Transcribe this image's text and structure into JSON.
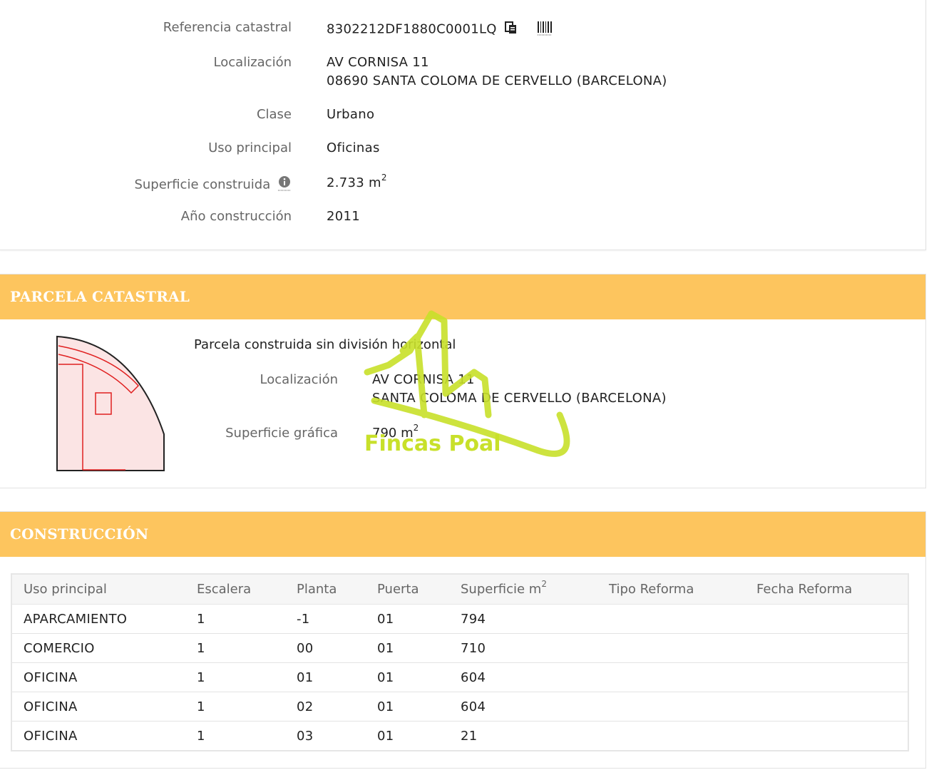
{
  "datos": {
    "referencia": {
      "label": "Referencia catastral",
      "value": "8302212DF1880C0001LQ"
    },
    "localizacion": {
      "label": "Localización",
      "line1": "AV CORNISA 11",
      "line2": "08690 SANTA COLOMA DE CERVELLO (BARCELONA)"
    },
    "clase": {
      "label": "Clase",
      "value": "Urbano"
    },
    "uso": {
      "label": "Uso principal",
      "value": "Oficinas"
    },
    "superficie": {
      "label": "Superficie construida",
      "value": "2.733 m",
      "sup": "2"
    },
    "anio": {
      "label": "Año construcción",
      "value": "2011"
    }
  },
  "parcela": {
    "title": "PARCELA CATASTRAL",
    "descripcion": "Parcela construida sin división horizontal",
    "localizacion": {
      "label": "Localización",
      "line1": "AV CORNISA 11",
      "line2": "SANTA COLOMA DE CERVELLO (BARCELONA)"
    },
    "superficie": {
      "label": "Superficie gráfica",
      "value": "790 m",
      "sup": "2"
    }
  },
  "watermark": {
    "text": "Fincas Poal",
    "color": "#c8e02a"
  },
  "construccion": {
    "title": "CONSTRUCCIÓN",
    "headers": [
      "Uso principal",
      "Escalera",
      "Planta",
      "Puerta",
      "Superficie m",
      "Tipo Reforma",
      "Fecha Reforma"
    ],
    "header_sup": "2",
    "rows": [
      [
        "APARCAMIENTO",
        "1",
        "-1",
        "01",
        "794",
        "",
        ""
      ],
      [
        "COMERCIO",
        "1",
        "00",
        "01",
        "710",
        "",
        ""
      ],
      [
        "OFICINA",
        "1",
        "01",
        "01",
        "604",
        "",
        ""
      ],
      [
        "OFICINA",
        "1",
        "02",
        "01",
        "604",
        "",
        ""
      ],
      [
        "OFICINA",
        "1",
        "03",
        "01",
        "21",
        "",
        ""
      ]
    ]
  },
  "colors": {
    "accent": "#fdc55e",
    "parcel_fill": "#fbe4e4",
    "parcel_line": "#e02020"
  }
}
